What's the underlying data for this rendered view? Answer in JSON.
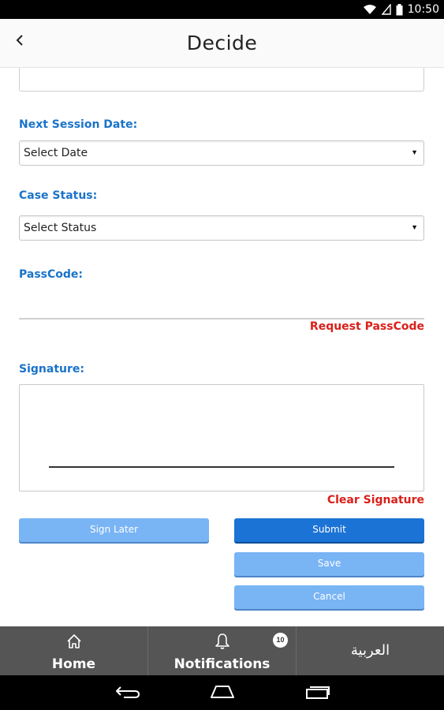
{
  "status_bar": {
    "time": "10:50"
  },
  "header": {
    "title": "Decide"
  },
  "form": {
    "next_session_label": "Next Session Date:",
    "next_session_value": "Select Date",
    "case_status_label": "Case Status:",
    "case_status_value": "Select Status",
    "passcode_label": "PassCode:",
    "request_passcode": "Request PassCode",
    "signature_label": "Signature:",
    "clear_signature": "Clear Signature"
  },
  "buttons": {
    "sign_later": "Sign Later",
    "submit": "Submit",
    "save": "Save",
    "cancel": "Cancel"
  },
  "bottom_nav": {
    "home": "Home",
    "notifications": "Notifications",
    "notifications_count": "10",
    "language": "العربية"
  },
  "colors": {
    "label_blue": "#1a73c9",
    "link_red": "#d9201a",
    "button_light": "#79b4f5",
    "button_dark": "#1b73d6",
    "bottom_nav_bg": "#555555"
  }
}
